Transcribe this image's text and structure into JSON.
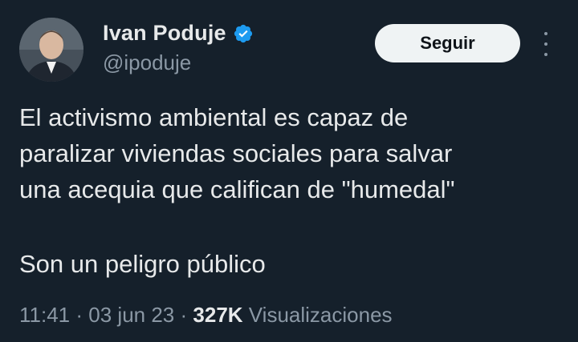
{
  "author": {
    "name": "Ivan Poduje",
    "handle": "@ipoduje",
    "verified": true,
    "verified_color": "#1d9bf0"
  },
  "actions": {
    "follow_label": "Seguir",
    "more_icon": "more-vertical-icon"
  },
  "tweet": {
    "lines": [
      "El activismo ambiental es capaz de",
      "paralizar viviendas sociales para salvar",
      "una acequia que califican de \"humedal\""
    ],
    "second_paragraph": "Son un peligro público"
  },
  "meta": {
    "time": "11:41",
    "separator": "·",
    "date": "03 jun 23",
    "views_count": "327K",
    "views_label": "Visualizaciones"
  },
  "colors": {
    "background": "#15202b",
    "text": "#e7e9ea",
    "secondary": "#8b98a5",
    "button_bg": "#eff3f4"
  }
}
